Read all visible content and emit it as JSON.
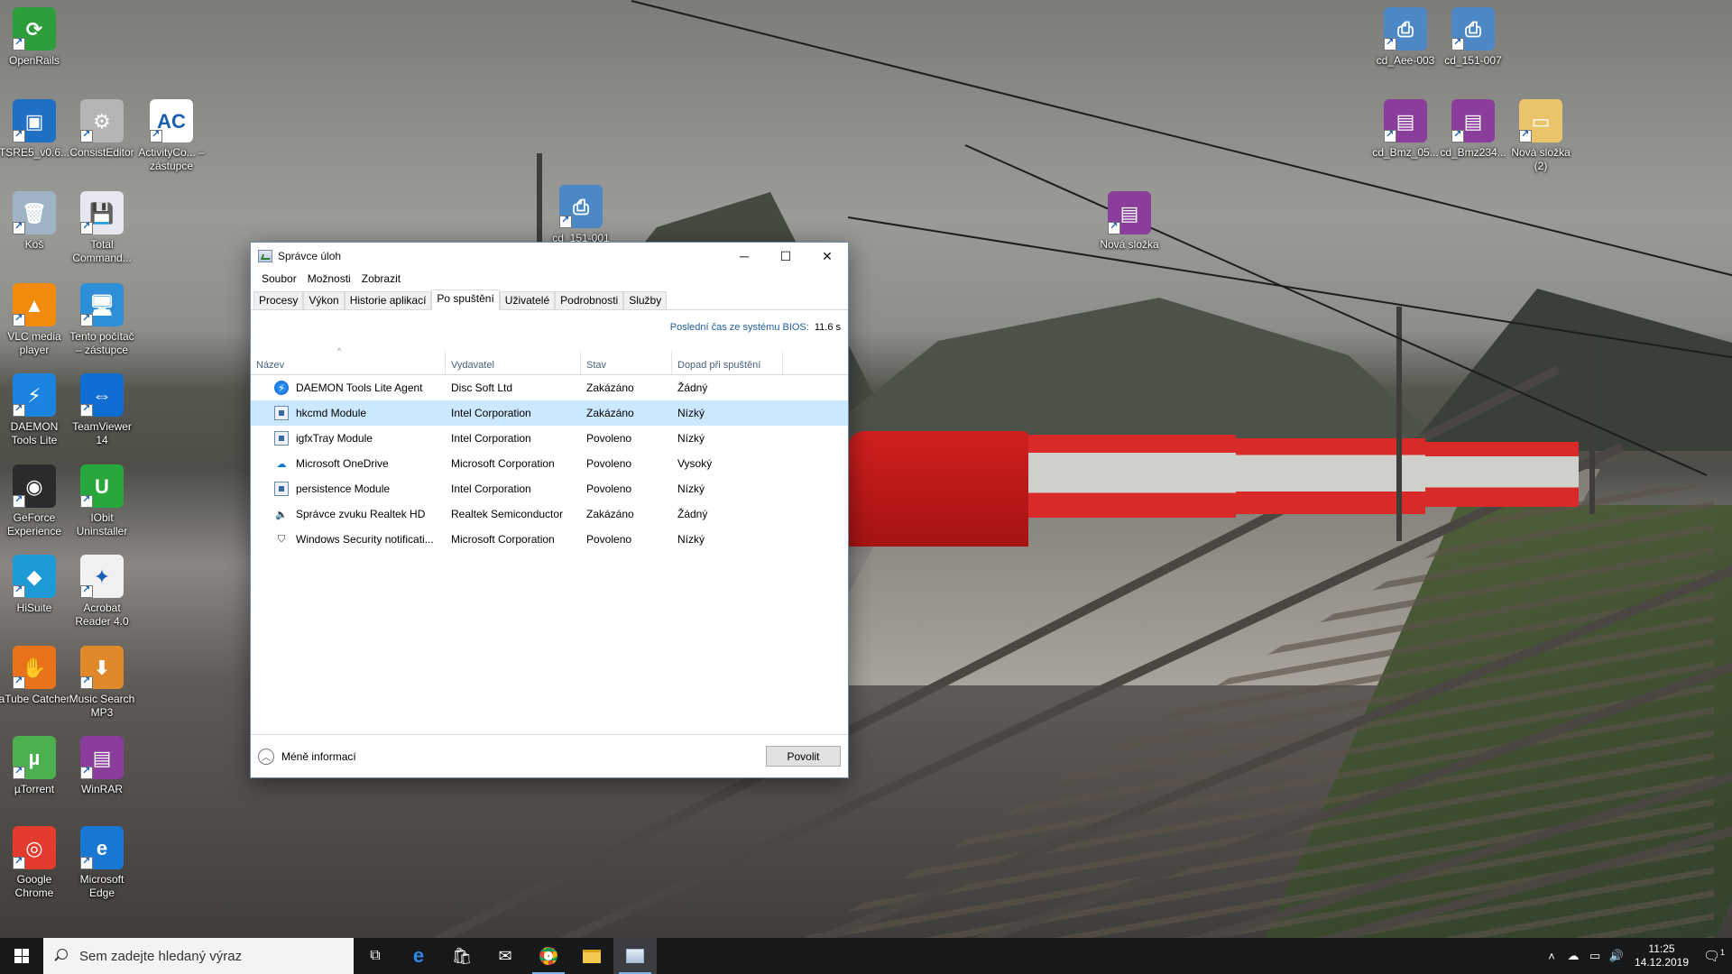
{
  "desktop": {
    "icons_left": [
      {
        "label": "OpenRails",
        "icon": "openrails-icon",
        "color": "#2e9e3d",
        "glyph": "⟳"
      },
      {
        "label": "TSRE5_v0.6...",
        "icon": "tsre-icon",
        "color": "#1f6fc4",
        "glyph": "▣"
      },
      {
        "label": "ConsistEditor",
        "icon": "consist-editor-icon",
        "color": "#b5b5b5",
        "glyph": "⚙"
      },
      {
        "label": "ActivityCo... – zástupce",
        "icon": "activity-editor-icon",
        "color": "#ffffff",
        "glyph": "AC"
      },
      {
        "label": "Koš",
        "icon": "recycle-bin-icon",
        "color": "#9fb3c5",
        "glyph": "🗑"
      },
      {
        "label": "Total Command...",
        "icon": "total-commander-icon",
        "color": "#e7e7ef",
        "glyph": "💾"
      },
      {
        "label": "VLC media player",
        "icon": "vlc-icon",
        "color": "#f28a0c",
        "glyph": "▲"
      },
      {
        "label": "Tento počítač – zástupce",
        "icon": "this-pc-icon",
        "color": "#2d8fd8",
        "glyph": "🖥"
      },
      {
        "label": "DAEMON Tools Lite",
        "icon": "daemon-tools-icon",
        "color": "#1b84e0",
        "glyph": "⚡"
      },
      {
        "label": "TeamViewer 14",
        "icon": "teamviewer-icon",
        "color": "#0e6ed4",
        "glyph": "⇔"
      },
      {
        "label": "GeForce Experience",
        "icon": "geforce-icon",
        "color": "#2b2b2b",
        "glyph": "◉"
      },
      {
        "label": "IObit Uninstaller",
        "icon": "iobit-icon",
        "color": "#27a83c",
        "glyph": "U"
      },
      {
        "label": "HiSuite",
        "icon": "hisuite-icon",
        "color": "#1e9ad6",
        "glyph": "◆"
      },
      {
        "label": "Acrobat Reader 4.0",
        "icon": "acrobat-icon",
        "color": "#f1f1f1",
        "glyph": "✦"
      },
      {
        "label": "aTube Catcher",
        "icon": "atube-catcher-icon",
        "color": "#e8731a",
        "glyph": "✋"
      },
      {
        "label": "Music Search MP3",
        "icon": "music-search-icon",
        "color": "#e0892b",
        "glyph": "⬇"
      },
      {
        "label": "µTorrent",
        "icon": "utorrent-icon",
        "color": "#4caf50",
        "glyph": "µ"
      },
      {
        "label": "WinRAR",
        "icon": "winrar-icon",
        "color": "#8a3d9b",
        "glyph": "▤"
      },
      {
        "label": "Google Chrome",
        "icon": "chrome-icon",
        "color": "#e33b2e",
        "glyph": "◎"
      },
      {
        "label": "Microsoft Edge",
        "icon": "edge-icon",
        "color": "#1877d2",
        "glyph": "e"
      }
    ],
    "icons_right": [
      {
        "label": "cd_Aee-003",
        "icon": "installer-icon",
        "color": "#4d88c6",
        "glyph": "⎙"
      },
      {
        "label": "cd_151-007",
        "icon": "installer-icon",
        "color": "#4d88c6",
        "glyph": "⎙"
      },
      {
        "label": "cd_Bmz_05...",
        "icon": "winrar-archive-icon",
        "color": "#8a3d9b",
        "glyph": "▤"
      },
      {
        "label": "cd_Bmz234...",
        "icon": "winrar-archive-icon",
        "color": "#8a3d9b",
        "glyph": "▤"
      },
      {
        "label": "Nová složka (2)",
        "icon": "folder-icon",
        "color": "#e9c46a",
        "glyph": "▭"
      },
      {
        "label": "Nová složka",
        "icon": "winrar-archive-icon",
        "color": "#8a3d9b",
        "glyph": "▤"
      },
      {
        "label": "cd_151-001",
        "icon": "installer-icon",
        "color": "#4d88c6",
        "glyph": "⎙"
      }
    ]
  },
  "task_manager": {
    "title": "Správce úloh",
    "menu": [
      "Soubor",
      "Možnosti",
      "Zobrazit"
    ],
    "tabs": [
      "Procesy",
      "Výkon",
      "Historie aplikací",
      "Po spuštění",
      "Uživatelé",
      "Podrobnosti",
      "Služby"
    ],
    "active_tab": "Po spuštění",
    "bios_label": "Poslední čas ze systému BIOS:",
    "bios_value": "11.6 s",
    "columns": [
      "Název",
      "Vydavatel",
      "Stav",
      "Dopad při spuštění"
    ],
    "rows": [
      {
        "name": "DAEMON Tools Lite Agent",
        "publisher": "Disc Soft Ltd",
        "state": "Zakázáno",
        "impact": "Žádný",
        "icon": "daemon-tools-icon"
      },
      {
        "name": "hkcmd Module",
        "publisher": "Intel Corporation",
        "state": "Zakázáno",
        "impact": "Nízký",
        "icon": "module-icon",
        "selected": true
      },
      {
        "name": "igfxTray Module",
        "publisher": "Intel Corporation",
        "state": "Povoleno",
        "impact": "Nízký",
        "icon": "module-icon"
      },
      {
        "name": "Microsoft OneDrive",
        "publisher": "Microsoft Corporation",
        "state": "Povoleno",
        "impact": "Vysoký",
        "icon": "onedrive-cloud-icon"
      },
      {
        "name": "persistence Module",
        "publisher": "Intel Corporation",
        "state": "Povoleno",
        "impact": "Nízký",
        "icon": "module-icon"
      },
      {
        "name": "Správce zvuku Realtek HD",
        "publisher": "Realtek Semiconductor",
        "state": "Zakázáno",
        "impact": "Žádný",
        "icon": "speaker-icon"
      },
      {
        "name": "Windows Security notificati...",
        "publisher": "Microsoft Corporation",
        "state": "Povoleno",
        "impact": "Nízký",
        "icon": "shield-icon"
      }
    ],
    "fewer_details": "Méně informací",
    "enable_button": "Povolit"
  },
  "taskbar": {
    "search_placeholder": "Sem zadejte hledaný výraz",
    "apps": [
      "task-view-icon",
      "edge-icon",
      "store-icon",
      "mail-icon",
      "chrome-icon",
      "file-explorer-icon",
      "task-manager-icon"
    ],
    "time": "11:25",
    "date": "14.12.2019",
    "notification_count": "1"
  }
}
